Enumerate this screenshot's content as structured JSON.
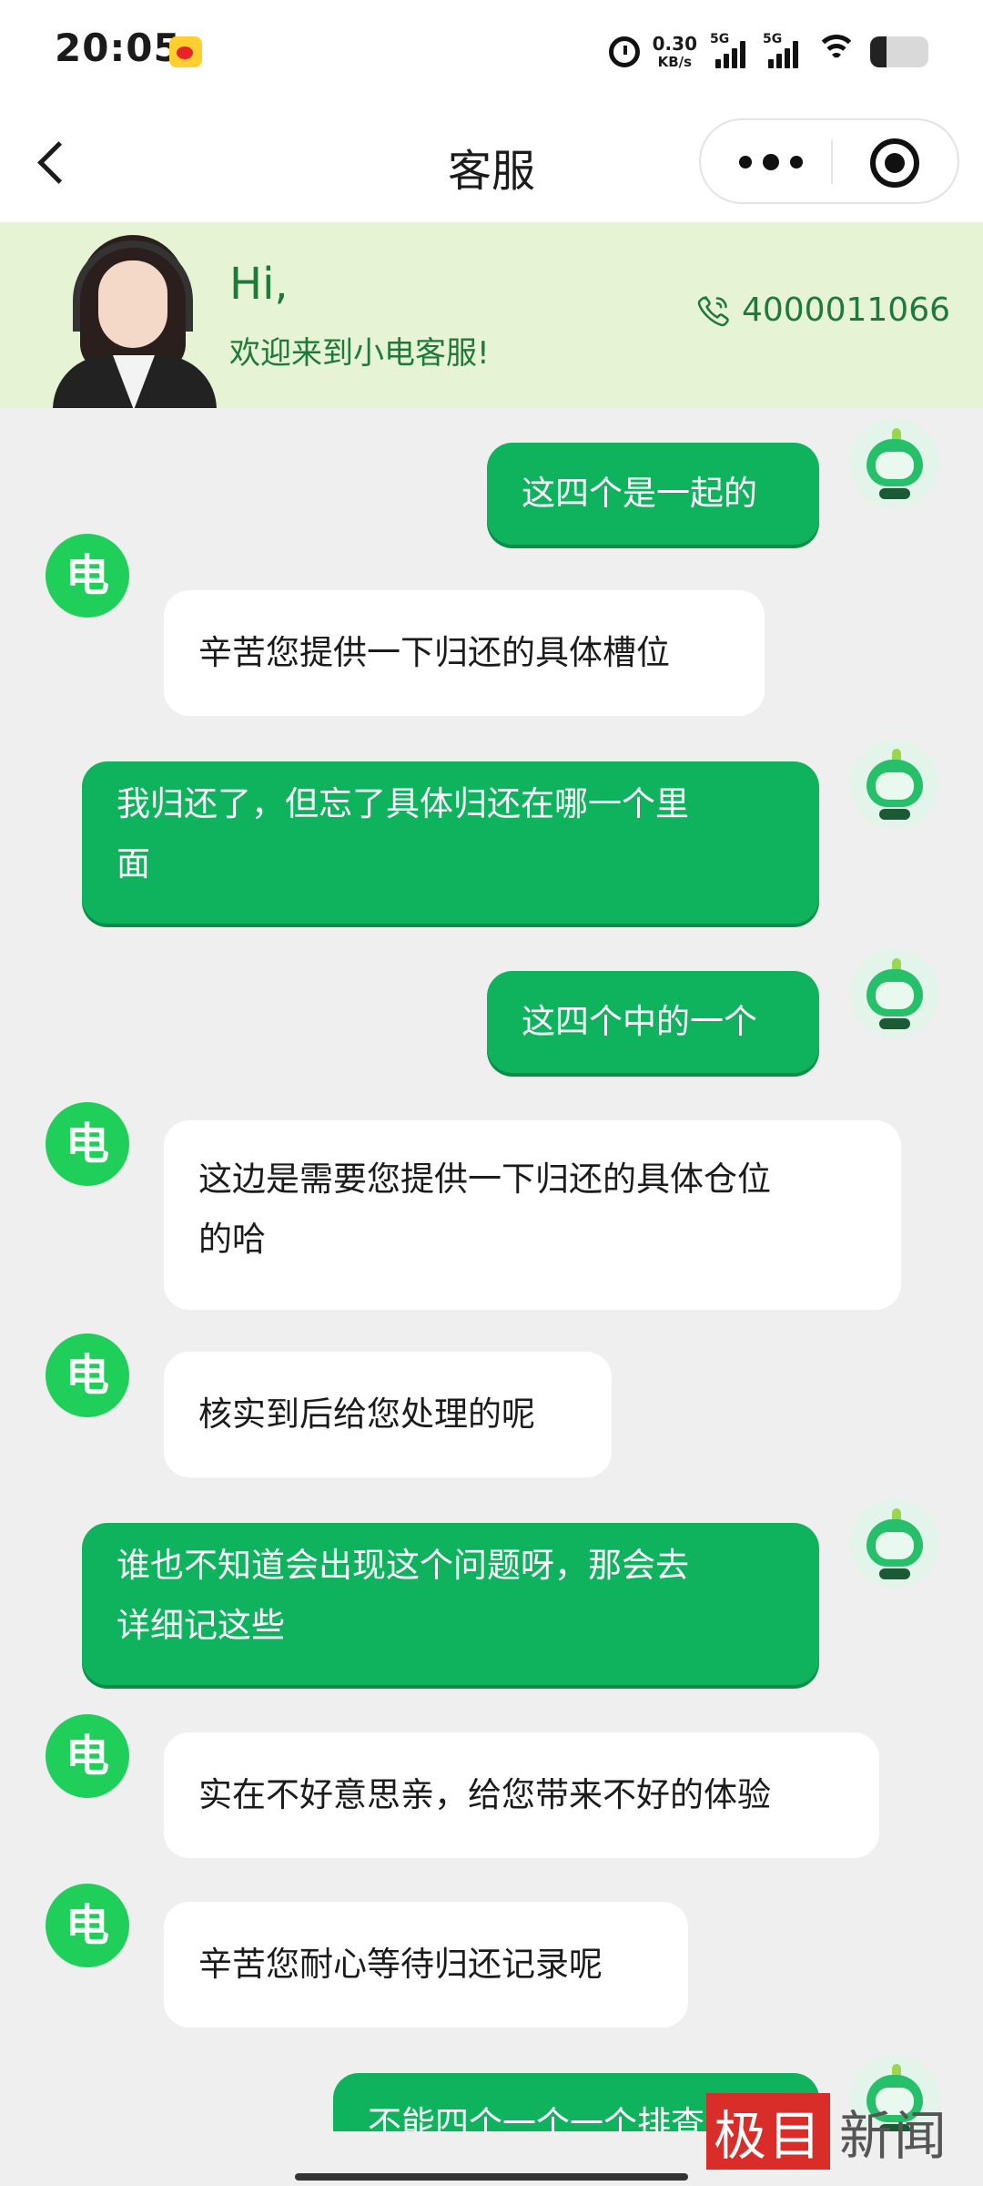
{
  "status_bar": {
    "time": "20:05",
    "net_speed_value": "0.30",
    "net_speed_unit": "KB/s",
    "signal_1": "5G",
    "signal_2": "5G",
    "notification_app_icon": "weibo-icon",
    "battery_level_percent": 30
  },
  "header": {
    "title": "客服",
    "back_icon": "chevron-left-icon",
    "more_icon": "more-dots-icon",
    "close_icon": "target-circle-icon"
  },
  "banner": {
    "greeting": "Hi,",
    "welcome": "欢迎来到小电客服!",
    "hotline": "4000011066",
    "hotline_icon": "phone-icon"
  },
  "chat": {
    "agent_avatar_glyph": "电",
    "messages": [
      {
        "from": "user",
        "text": "这四个是一起的"
      },
      {
        "from": "agent",
        "text": "辛苦您提供一下归还的具体槽位"
      },
      {
        "from": "user",
        "text_lines": [
          "我归还了，但忘了具体归还在哪一个里",
          "面"
        ]
      },
      {
        "from": "user",
        "text": "这四个中的一个"
      },
      {
        "from": "agent",
        "text_lines": [
          "这边是需要您提供一下归还的具体仓位",
          "的哈"
        ]
      },
      {
        "from": "agent",
        "text": "核实到后给您处理的呢"
      },
      {
        "from": "user",
        "text_lines": [
          "谁也不知道会出现这个问题呀，那会去",
          "详细记这些"
        ]
      },
      {
        "from": "agent",
        "text": "实在不好意思亲，给您带来不好的体验"
      },
      {
        "from": "agent",
        "text": "辛苦您耐心等待归还记录呢"
      },
      {
        "from": "user",
        "text": "不能四个一个一个排查吗"
      }
    ]
  },
  "watermark": {
    "boxed": "极目",
    "plain": "新闻"
  },
  "colors": {
    "user_bubble": "#0fb35d",
    "agent_avatar": "#1fcf59",
    "banner_bg": "#e6f3d4",
    "accent_text": "#1e7a3b",
    "chat_bg": "#efefef"
  }
}
